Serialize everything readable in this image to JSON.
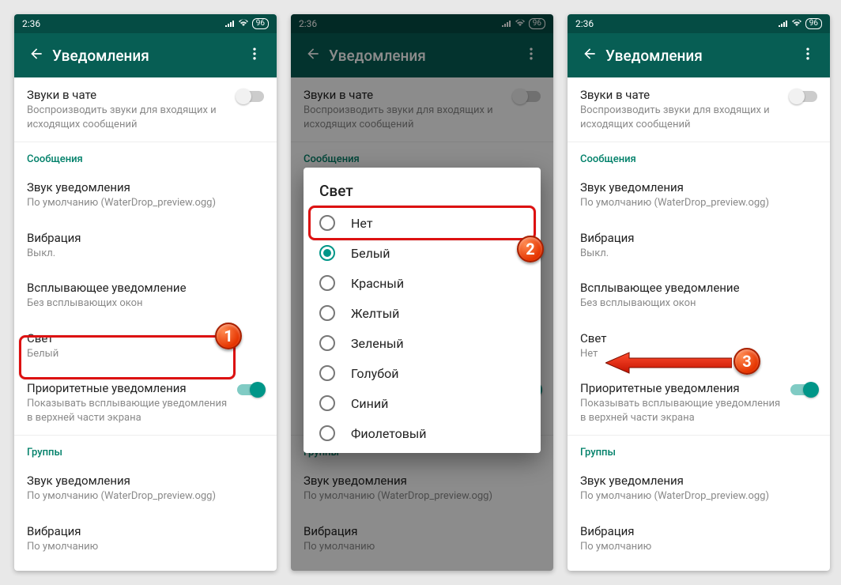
{
  "status": {
    "time": "2:36",
    "battery": "96"
  },
  "appbar": {
    "title": "Уведомления"
  },
  "chat_sounds": {
    "title": "Звуки в чате",
    "sub": "Воспроизводить звуки для входящих и исходящих сообщений"
  },
  "sections": {
    "messages": "Сообщения",
    "groups": "Группы"
  },
  "items": {
    "notif_sound": {
      "title": "Звук уведомления",
      "sub": "По умолчанию (WaterDrop_preview.ogg)"
    },
    "vibration": {
      "title": "Вибрация",
      "sub_off": "Выкл.",
      "sub_default": "По умолчанию"
    },
    "popup": {
      "title": "Всплывающее уведомление",
      "sub": "Без всплывающих окон"
    },
    "light": {
      "title": "Свет",
      "sub_white": "Белый",
      "sub_none": "Нет"
    },
    "priority": {
      "title": "Приоритетные уведомления",
      "sub": "Показывать всплывающие уведомления в верхней части экрана"
    }
  },
  "dialog": {
    "title": "Свет",
    "options": [
      "Нет",
      "Белый",
      "Красный",
      "Желтый",
      "Зеленый",
      "Голубой",
      "Синий",
      "Фиолетовый"
    ],
    "selected": 1
  },
  "annotations": {
    "b1": "1",
    "b2": "2",
    "b3": "3"
  }
}
